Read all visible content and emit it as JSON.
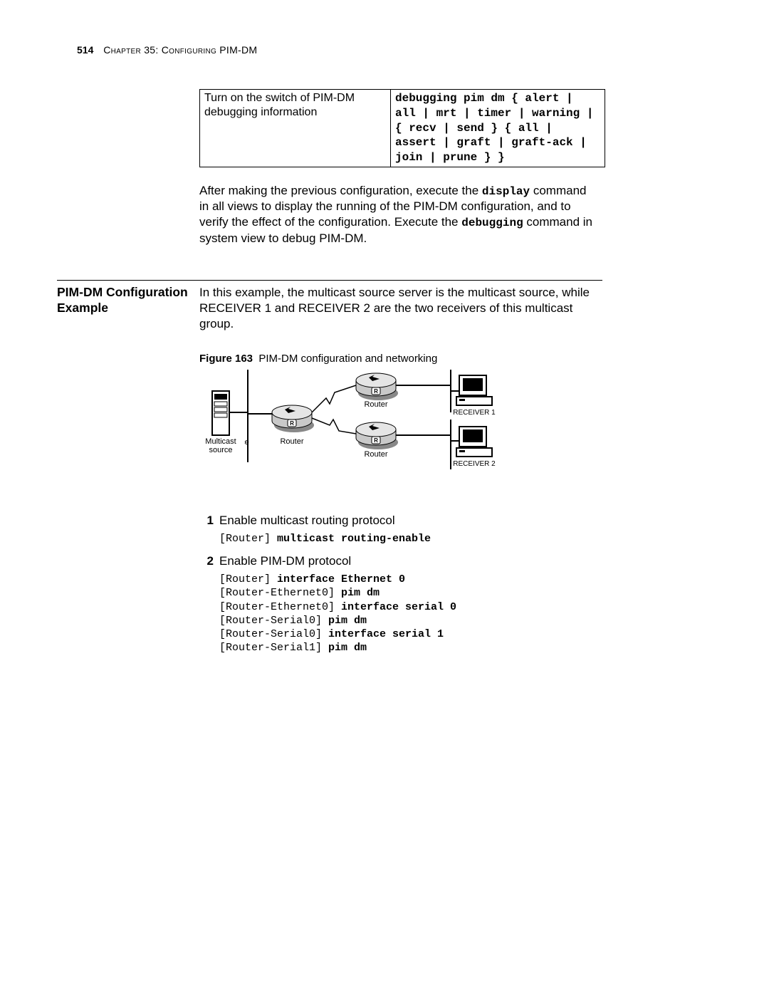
{
  "header": {
    "page_number": "514",
    "chapter": "Chapter 35: Configuring PIM-DM"
  },
  "table": {
    "left": "Turn on the switch of PIM-DM debugging information",
    "right": "debugging pim dm { alert | all | mrt | timer | warning | { recv | send } { all | assert | graft | graft-ack | join | prune } }"
  },
  "para1_pre": "After making the previous configuration, execute the ",
  "para1_cmd1": "display",
  "para1_mid": " command in all views to display the running of the PIM-DM configuration, and to verify the effect of the configuration. Execute the ",
  "para1_cmd2": "debugging",
  "para1_post": " command in system view to debug PIM-DM.",
  "section": {
    "title": "PIM-DM Configuration Example",
    "intro": "In this example, the multicast source server is the multicast source, while RECEIVER 1 and RECEIVER 2 are the two receivers of this multicast group."
  },
  "figure": {
    "label": "Figure 163",
    "caption": "PIM-DM configuration and networking",
    "labels": {
      "source": "Multicast source",
      "router": "Router",
      "receiver1": "RECEIVER 1",
      "receiver2": "RECEIVER 2"
    }
  },
  "steps": [
    {
      "n": "1",
      "text": "Enable multicast routing protocol",
      "cmds": [
        {
          "p": "[Router] ",
          "b": "multicast routing-enable"
        }
      ]
    },
    {
      "n": "2",
      "text": "Enable PIM-DM protocol",
      "cmds": [
        {
          "p": "[Router] ",
          "b": "interface Ethernet 0"
        },
        {
          "p": "[Router-Ethernet0] ",
          "b": "pim dm"
        },
        {
          "p": "[Router-Ethernet0] ",
          "b": "interface serial 0"
        },
        {
          "p": "[Router-Serial0] ",
          "b": "pim dm"
        },
        {
          "p": "[Router-Serial0] ",
          "b": "interface serial 1"
        },
        {
          "p": "[Router-Serial1] ",
          "b": "pim dm"
        }
      ]
    }
  ]
}
